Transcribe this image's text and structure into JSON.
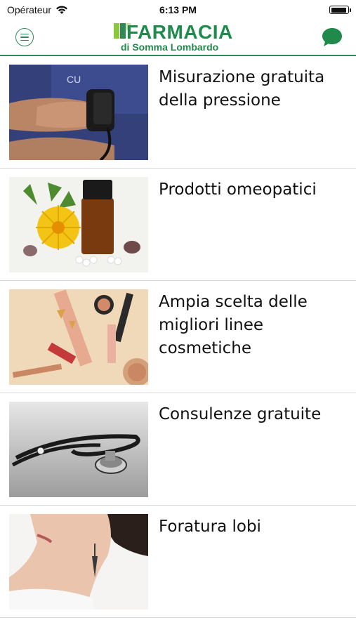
{
  "status_bar": {
    "carrier": "Opérateur",
    "time": "6:13 PM"
  },
  "header": {
    "logo_title": "FARMACIA",
    "logo_subtitle": "di Somma Lombardo",
    "brand_color": "#1f8a4c",
    "menu_icon": "menu-icon",
    "chat_icon": "chat-bubble-icon"
  },
  "services": [
    {
      "title": "Misurazione gratuita della pressione",
      "image": "blood-pressure-photo"
    },
    {
      "title": "Prodotti omeopatici",
      "image": "homeopathy-photo"
    },
    {
      "title": "Ampia scelta delle migliori linee cosmetiche",
      "image": "cosmetics-photo"
    },
    {
      "title": "Consulenze gratuite",
      "image": "stethoscope-photo"
    },
    {
      "title": "Foratura lobi",
      "image": "earring-photo"
    }
  ]
}
